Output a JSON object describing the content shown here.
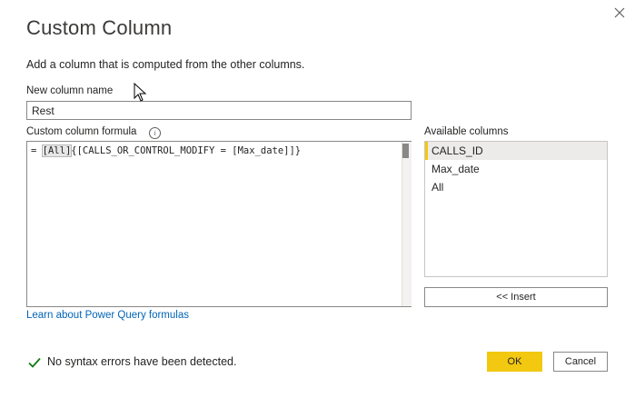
{
  "dialog": {
    "title": "Custom Column",
    "subtitle": "Add a column that is computed from the other columns."
  },
  "name_field": {
    "label": "New column name",
    "value": "Rest"
  },
  "formula": {
    "label": "Custom column formula",
    "info_icon": "info-icon",
    "prefix": "= ",
    "highlighted": "[All]",
    "rest": "{[CALLS_OR_CONTROL_MODIFY = [Max_date]]}"
  },
  "available": {
    "label": "Available columns",
    "items": [
      "CALLS_ID",
      "Max_date",
      "All"
    ],
    "selected_index": 0
  },
  "insert_label": "<< Insert",
  "learn_link": "Learn about Power Query formulas",
  "status": {
    "icon": "checkmark-icon",
    "text": "No syntax errors have been detected.",
    "color": "#107c10"
  },
  "buttons": {
    "ok": "OK",
    "cancel": "Cancel"
  },
  "colors": {
    "accent": "#f2c811",
    "link": "#0064b7"
  }
}
